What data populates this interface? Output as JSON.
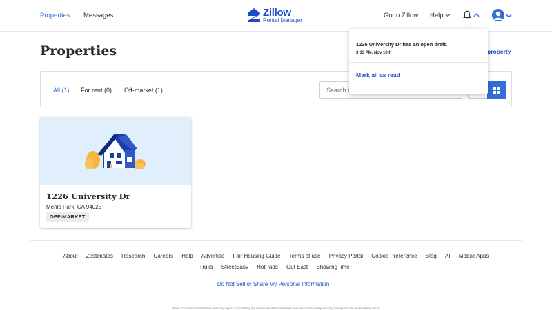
{
  "nav": {
    "properties": "Properties",
    "messages": "Messages",
    "goto_zillow": "Go to Zillow",
    "help": "Help",
    "logo_word": "Zillow",
    "logo_sub": "Rental Manager"
  },
  "page": {
    "title": "Properties",
    "add_property": "property"
  },
  "filters": {
    "tabs": [
      {
        "label": "All (1)",
        "active": true
      },
      {
        "label": "For rent (0)",
        "active": false
      },
      {
        "label": "Off-market (1)",
        "active": false
      }
    ],
    "search_placeholder": "Search by address"
  },
  "property": {
    "address_line1": "1226 University Dr",
    "address_line2": "Menlo Park, CA 94025",
    "status": "OFF-MARKET"
  },
  "notification": {
    "message": "1226 University Dr has an open draft.",
    "time": "3:13 PM, Nov 10th",
    "mark_all": "Mark all as read"
  },
  "footer": {
    "row1": [
      "About",
      "Zestimates",
      "Research",
      "Careers",
      "Help",
      "Advertise",
      "Fair Housing Guide",
      "Terms of use",
      "Privacy Portal",
      "Cookie Preference",
      "Blog",
      "AI",
      "Mobile Apps"
    ],
    "row2": [
      "Trulia",
      "StreetEasy",
      "HotPads",
      "Out East",
      "ShowingTime+"
    ],
    "do_not_sell": "Do Not Sell or Share My Personal Information→",
    "small_text": "Zillow Group is committed to ensuring digital accessibility for individuals with disabilities. We are continuously working to improve the accessibility of our"
  },
  "colors": {
    "accent": "#2f6fd6",
    "brand": "#1a4fc4",
    "card_bg": "#e1effd",
    "text": "#2a2a33"
  },
  "icons": [
    "zillow-logo-icon",
    "chevron-down-icon",
    "bell-icon",
    "chevron-up-icon",
    "user-avatar-icon",
    "grid-view-icon",
    "list-view-icon",
    "house-illustration-icon"
  ]
}
